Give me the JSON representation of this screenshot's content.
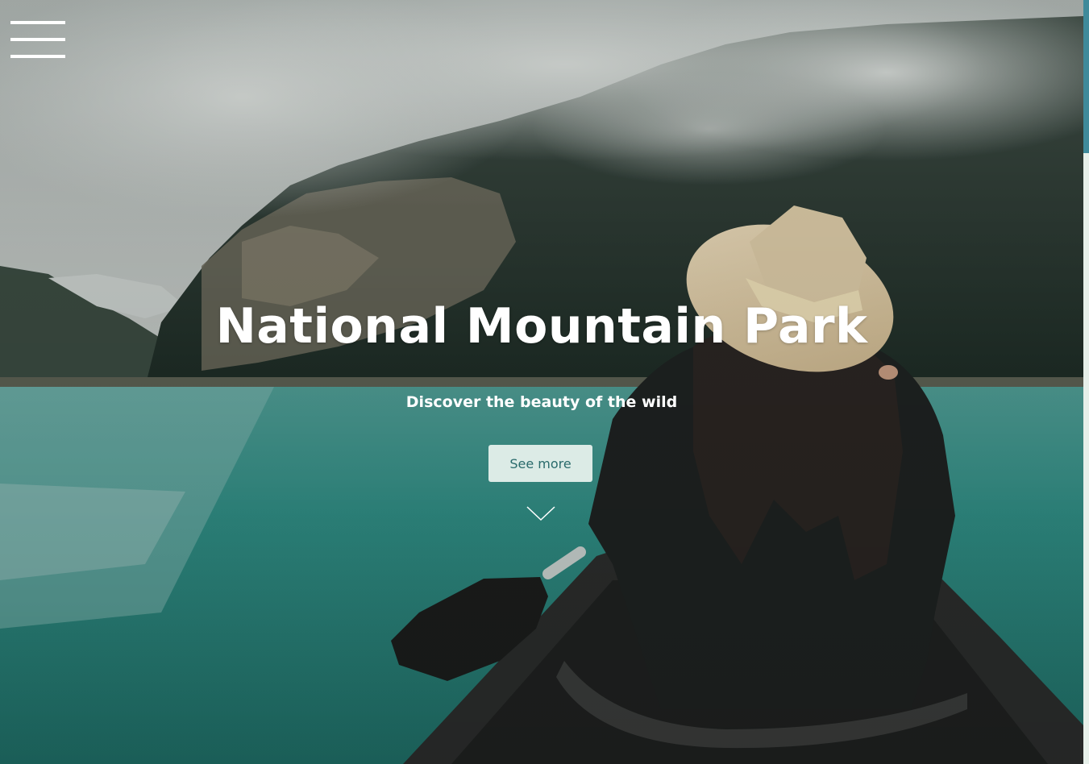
{
  "hero": {
    "title": "National Mountain Park",
    "subtitle": "Discover the beauty of the wild",
    "cta_label": "See more"
  },
  "icons": {
    "menu": "hamburger-menu-icon",
    "scroll": "chevron-down-icon"
  },
  "colors": {
    "button_bg": "#dcebe6",
    "button_text": "#2a6b6c",
    "scrollbar_thumb": "#3f8a9a",
    "lake": "#2f8d84"
  }
}
